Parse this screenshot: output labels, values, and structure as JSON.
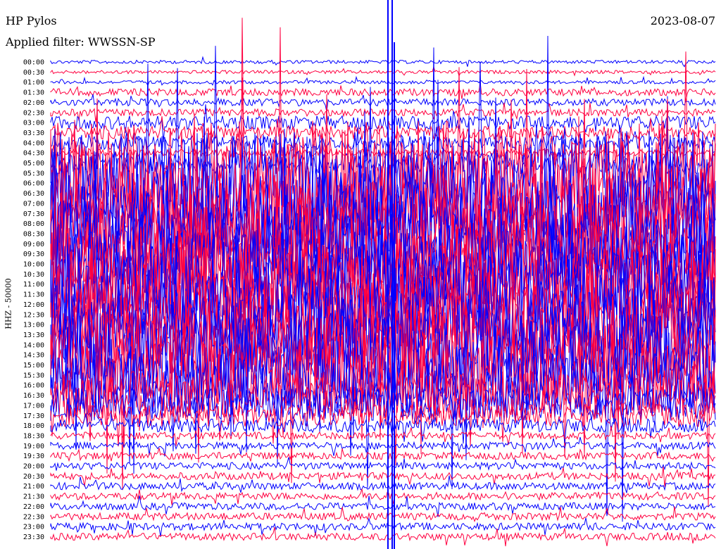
{
  "header": {
    "station": "HP Pylos",
    "filter": "Applied filter: WWSSN-SP",
    "date": "2023-08-07"
  },
  "channel_label": "HHZ - 50000",
  "colors": {
    "even_trace": "#0000ff",
    "odd_trace": "#ff0040",
    "background": "#ffffff"
  },
  "chart_data": {
    "type": "line",
    "title": "",
    "ylabel": "HHZ - 50000",
    "xlabel": "",
    "grid": false,
    "legend": "none",
    "categories": [
      "00:00",
      "00:30",
      "01:00",
      "01:30",
      "02:00",
      "02:30",
      "03:00",
      "03:30",
      "04:00",
      "04:30",
      "05:00",
      "05:30",
      "06:00",
      "06:30",
      "07:00",
      "07:30",
      "08:00",
      "08:30",
      "09:00",
      "09:30",
      "10:00",
      "10:30",
      "11:00",
      "11:30",
      "12:00",
      "12:30",
      "13:00",
      "13:30",
      "14:00",
      "14:30",
      "15:00",
      "15:30",
      "16:00",
      "16:30",
      "17:00",
      "17:30",
      "18:00",
      "18:30",
      "19:00",
      "19:30",
      "20:00",
      "20:30",
      "21:00",
      "21:30",
      "22:00",
      "22:30",
      "23:00",
      "23:30"
    ],
    "trace_activity_level": [
      1,
      1,
      1,
      2,
      2,
      2,
      3,
      3,
      3,
      2,
      4,
      9,
      9,
      9,
      9,
      9,
      9,
      9,
      9,
      9,
      9,
      9,
      9,
      9,
      9,
      9,
      9,
      9,
      9,
      9,
      9,
      8,
      7,
      6,
      5,
      4,
      3,
      2,
      2,
      2,
      2,
      2,
      2,
      2,
      2,
      2,
      2,
      2
    ]
  }
}
